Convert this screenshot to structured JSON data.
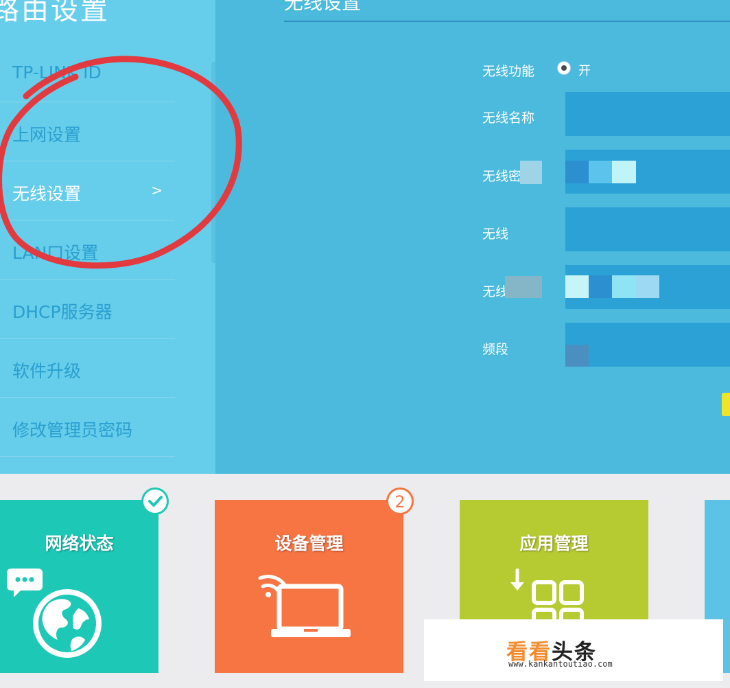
{
  "sidebar": {
    "title": "路由设置",
    "items": [
      {
        "label": "TP-LINK ID"
      },
      {
        "label": "上网设置"
      },
      {
        "label": "无线设置",
        "active": true,
        "chevron": ">"
      },
      {
        "label": "LAN口设置"
      },
      {
        "label": "DHCP服务器"
      },
      {
        "label": "软件升级"
      },
      {
        "label": "修改管理员密码"
      }
    ]
  },
  "main": {
    "title": "无线设置",
    "form": {
      "wireless_function": {
        "label": "无线功能",
        "option": "开"
      },
      "wireless_name": {
        "label": "无线名称"
      },
      "wireless_password": {
        "label": "无线密"
      },
      "row3": {
        "label": "无线"
      },
      "row4": {
        "label": "无线"
      },
      "band": {
        "label": "频段"
      }
    }
  },
  "tiles": [
    {
      "title": "网络状态",
      "color": "#1dc8b6",
      "badge": "check-icon"
    },
    {
      "title": "设备管理",
      "color": "#f67543",
      "badge": "2"
    },
    {
      "title": "应用管理",
      "color": "#b6ca32"
    }
  ],
  "watermark": {
    "brand_a": "看看",
    "brand_b": "头条",
    "url": "www.kankantoutiao.com"
  },
  "colors": {
    "sidebar": "#66cdea",
    "main": "#4bbadd",
    "annotation": "#e23a3f"
  }
}
